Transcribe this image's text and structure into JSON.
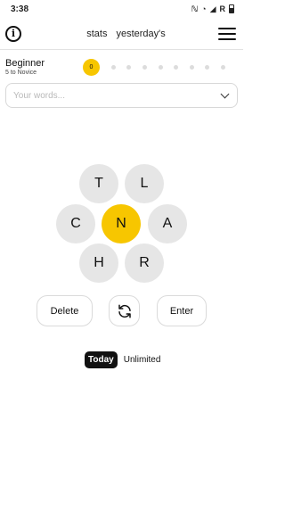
{
  "status_bar": {
    "time": "3:38",
    "icons": [
      "nfc-icon",
      "wifi-icon",
      "signal-icon",
      "R",
      "battery-icon"
    ]
  },
  "header": {
    "info_icon": "ⓘ",
    "links": [
      "stats",
      "yesterday's"
    ],
    "menu_icon": "menu-icon"
  },
  "rank": {
    "title": "Beginner",
    "subtitle": "5 to Novice",
    "score": "0",
    "levels_total": 9,
    "current_level": 1
  },
  "words_input": {
    "placeholder": "Your words..."
  },
  "hive": {
    "center": "N",
    "outer": [
      "T",
      "L",
      "C",
      "A",
      "H",
      "R"
    ]
  },
  "controls": {
    "delete": "Delete",
    "shuffle_icon": "refresh-icon",
    "enter": "Enter"
  },
  "modes": {
    "today": "Today",
    "unlimited": "Unlimited"
  },
  "colors": {
    "accent": "#f7c600",
    "cell": "#e6e6e6"
  }
}
